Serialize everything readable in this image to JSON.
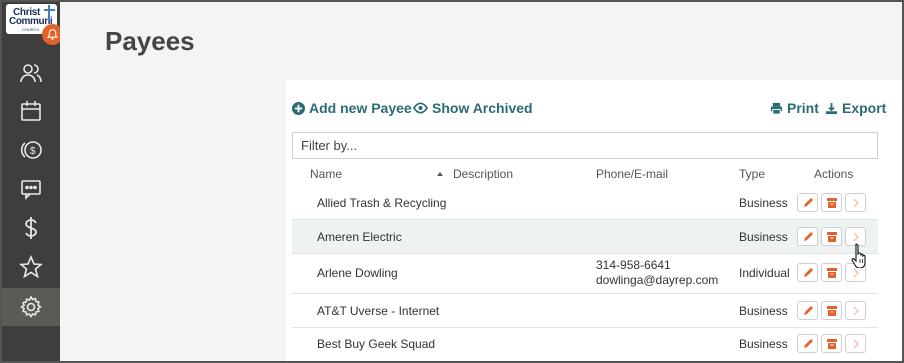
{
  "logo": {
    "line1": "Christ",
    "line2": "Communi",
    "line3": "CHURCH"
  },
  "sidebar": {
    "items": [
      {
        "name": "people",
        "icon": "people-icon"
      },
      {
        "name": "calendar",
        "icon": "calendar-icon"
      },
      {
        "name": "giving",
        "icon": "coin-icon"
      },
      {
        "name": "messages",
        "icon": "chat-icon"
      },
      {
        "name": "finance",
        "icon": "dollar-icon"
      },
      {
        "name": "favorites",
        "icon": "star-icon"
      },
      {
        "name": "settings",
        "icon": "gear-icon",
        "active": true
      }
    ]
  },
  "page": {
    "title": "Payees"
  },
  "toolbar": {
    "add_label": "Add new Payee",
    "archived_label": "Show Archived",
    "print_label": "Print",
    "export_label": "Export"
  },
  "filter": {
    "placeholder": "Filter by..."
  },
  "table": {
    "columns": [
      "Name",
      "Description",
      "Phone/E-mail",
      "Type",
      "Actions"
    ],
    "rows": [
      {
        "name": "Allied Trash & Recycling",
        "description": "",
        "phone": "",
        "email": "",
        "type": "Business"
      },
      {
        "name": "Ameren Electric",
        "description": "",
        "phone": "",
        "email": "",
        "type": "Business"
      },
      {
        "name": "Arlene Dowling",
        "description": "",
        "phone": "314-958-6641",
        "email": "dowlinga@dayrep.com",
        "type": "Individual"
      },
      {
        "name": "AT&T Uverse - Internet",
        "description": "",
        "phone": "",
        "email": "",
        "type": "Business"
      },
      {
        "name": "Best Buy Geek Squad",
        "description": "",
        "phone": "",
        "email": "",
        "type": "Business"
      }
    ]
  },
  "colors": {
    "accent": "#2b6b76",
    "action_orange": "#e2622a",
    "sidebar": "#3f3e3c"
  }
}
